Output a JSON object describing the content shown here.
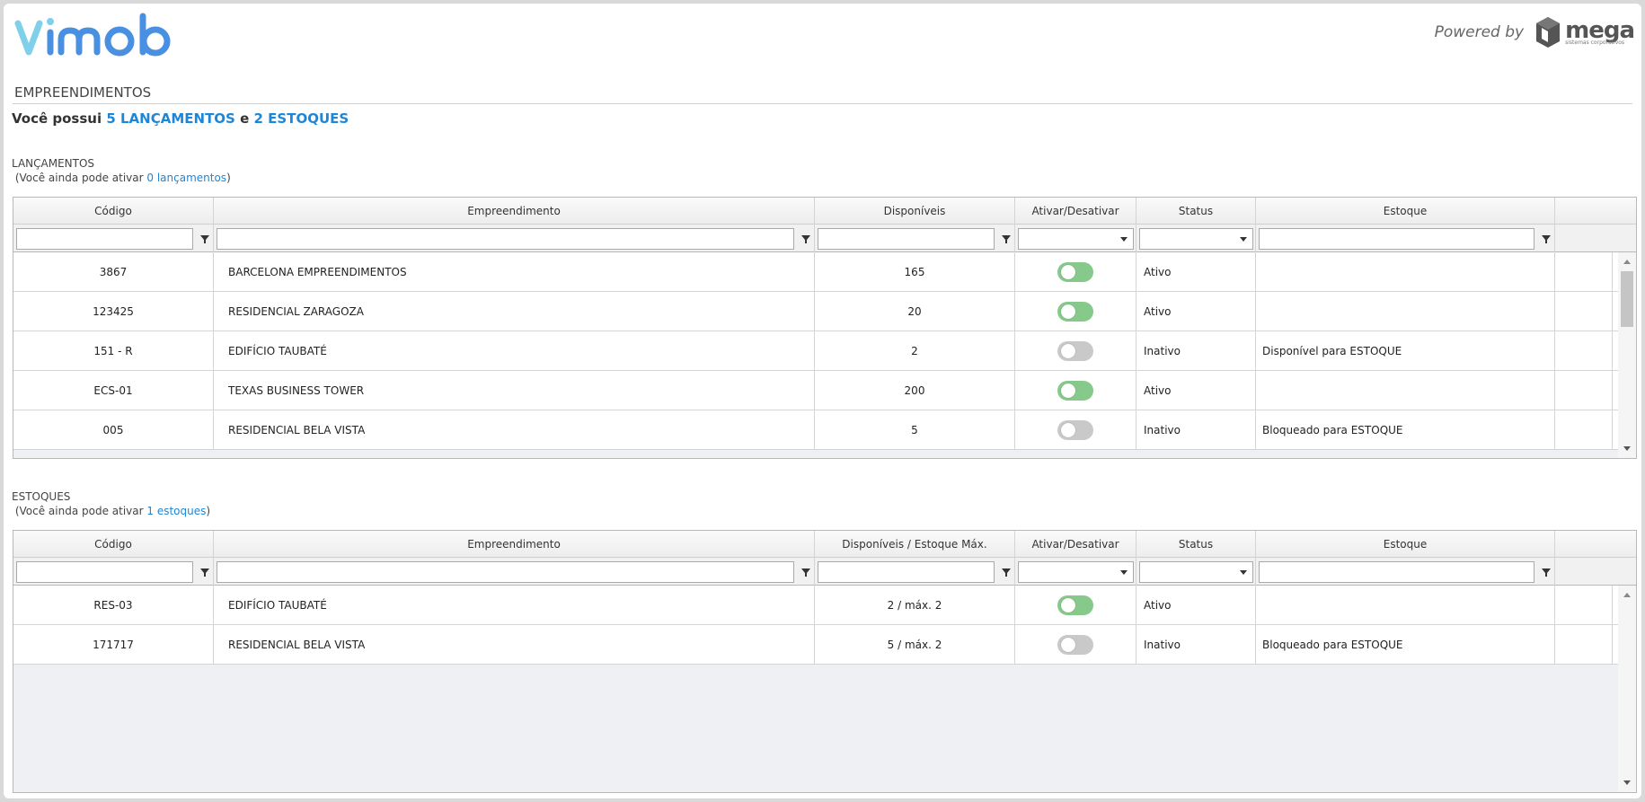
{
  "header": {
    "powered_by": "Powered by",
    "brand": "mega",
    "brand_sub": "sistemas corporativos"
  },
  "page": {
    "title": "EMPREENDIMENTOS",
    "summary_prefix": "Você possui",
    "summary_launches": "5 LANÇAMENTOS",
    "summary_join": "e",
    "summary_stocks": "2 ESTOQUES"
  },
  "lancamentos": {
    "title": "LANÇAMENTOS",
    "note_prefix": "(Você ainda pode ativar",
    "note_link": "0 lançamentos",
    "note_suffix": ")",
    "columns": [
      "Código",
      "Empreendimento",
      "Disponíveis",
      "Ativar/Desativar",
      "Status",
      "Estoque"
    ],
    "rows": [
      {
        "codigo": "3867",
        "empreendimento": "BARCELONA EMPREENDIMENTOS",
        "disponiveis": "165",
        "ativo": true,
        "status": "Ativo",
        "estoque": ""
      },
      {
        "codigo": "123425",
        "empreendimento": "RESIDENCIAL ZARAGOZA",
        "disponiveis": "20",
        "ativo": true,
        "status": "Ativo",
        "estoque": ""
      },
      {
        "codigo": "151 - R",
        "empreendimento": "EDIFÍCIO TAUBATÉ",
        "disponiveis": "2",
        "ativo": false,
        "status": "Inativo",
        "estoque": "Disponível para ESTOQUE"
      },
      {
        "codigo": "ECS-01",
        "empreendimento": "TEXAS BUSINESS TOWER",
        "disponiveis": "200",
        "ativo": true,
        "status": "Ativo",
        "estoque": ""
      },
      {
        "codigo": "005",
        "empreendimento": "RESIDENCIAL BELA VISTA",
        "disponiveis": "5",
        "ativo": false,
        "status": "Inativo",
        "estoque": "Bloqueado para ESTOQUE"
      }
    ]
  },
  "estoques": {
    "title": "ESTOQUES",
    "note_prefix": "(Você ainda pode ativar",
    "note_link": "1 estoques",
    "note_suffix": ")",
    "columns": [
      "Código",
      "Empreendimento",
      "Disponíveis / Estoque Máx.",
      "Ativar/Desativar",
      "Status",
      "Estoque"
    ],
    "rows": [
      {
        "codigo": "RES-03",
        "empreendimento": "EDIFÍCIO TAUBATÉ",
        "disponiveis": "2 / máx. 2",
        "ativo": true,
        "status": "Ativo",
        "estoque": ""
      },
      {
        "codigo": "171717",
        "empreendimento": "RESIDENCIAL BELA VISTA",
        "disponiveis": "5 / máx. 2",
        "ativo": false,
        "status": "Inativo",
        "estoque": "Bloqueado para ESTOQUE"
      }
    ]
  },
  "colors": {
    "accent": "#1e86d6",
    "toggle_on": "#86c98a",
    "toggle_off": "#c9c9c9",
    "logo_blue": "#4a90e2",
    "logo_cyan": "#7fd0e8"
  }
}
